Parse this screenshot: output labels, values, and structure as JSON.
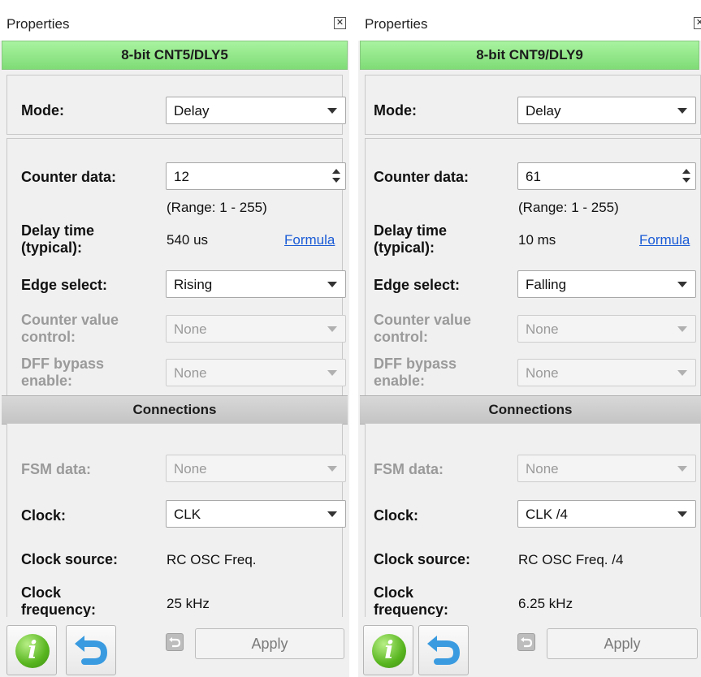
{
  "panels": [
    {
      "window_title": "Properties",
      "close_glyph": "✕",
      "block_title": "8-bit CNT5/DLY5",
      "mode_label": "Mode:",
      "mode_value": "Delay",
      "counter_data_label": "Counter data:",
      "counter_data_value": "12",
      "range_text": "(Range:  1 - 255)",
      "delay_time_label_1": "Delay time",
      "delay_time_label_2": "(typical):",
      "delay_time_value": "540 us",
      "formula_link": "Formula",
      "edge_select_label": "Edge select:",
      "edge_select_value": "Rising",
      "counter_value_control_label_1": "Counter value",
      "counter_value_control_label_2": "control:",
      "counter_value_control_value": "None",
      "dff_bypass_label_1": "DFF bypass",
      "dff_bypass_label_2": "enable:",
      "dff_bypass_value": "None",
      "connections_title": "Connections",
      "fsm_data_label": "FSM data:",
      "fsm_data_value": "None",
      "clock_label": "Clock:",
      "clock_value": "CLK",
      "clock_source_label": "Clock source:",
      "clock_source_value": "RC OSC Freq.",
      "clock_frequency_label_1": "Clock",
      "clock_frequency_label_2": "frequency:",
      "clock_frequency_value": "25 kHz",
      "apply_label": "Apply"
    },
    {
      "window_title": "Properties",
      "close_glyph": "✕",
      "block_title": "8-bit CNT9/DLY9",
      "mode_label": "Mode:",
      "mode_value": "Delay",
      "counter_data_label": "Counter data:",
      "counter_data_value": "61",
      "range_text": "(Range:  1 - 255)",
      "delay_time_label_1": "Delay time",
      "delay_time_label_2": "(typical):",
      "delay_time_value": "10 ms",
      "formula_link": "Formula",
      "edge_select_label": "Edge select:",
      "edge_select_value": "Falling",
      "counter_value_control_label_1": "Counter value",
      "counter_value_control_label_2": "control:",
      "counter_value_control_value": "None",
      "dff_bypass_label_1": "DFF bypass",
      "dff_bypass_label_2": "enable:",
      "dff_bypass_value": "None",
      "connections_title": "Connections",
      "fsm_data_label": "FSM data:",
      "fsm_data_value": "None",
      "clock_label": "Clock:",
      "clock_value": "CLK /4",
      "clock_source_label": "Clock source:",
      "clock_source_value": "RC OSC Freq. /4",
      "clock_frequency_label_1": "Clock",
      "clock_frequency_label_2": "frequency:",
      "clock_frequency_value": "6.25 kHz",
      "apply_label": "Apply"
    }
  ],
  "icons": {
    "info": "info-icon",
    "undo": "undo-arrow-icon",
    "small_undo": "small-undo-icon",
    "close": "close-icon",
    "dropdown": "chevron-down-icon",
    "spinner": "spinner-arrows-icon"
  },
  "colors": {
    "header_green": "#8fe586",
    "connections_grey": "#cccccc",
    "link_blue": "#1a5bd6",
    "info_green": "#58b51f",
    "undo_blue": "#3a9be0"
  }
}
